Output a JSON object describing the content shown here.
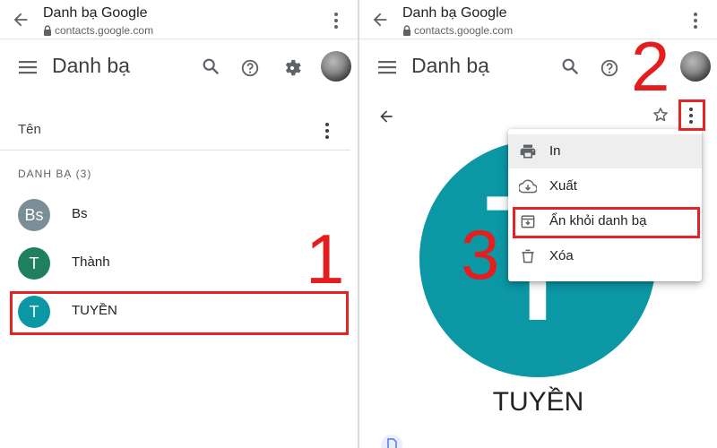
{
  "browser": {
    "page_title": "Danh bạ Google",
    "url": "contacts.google.com"
  },
  "app": {
    "title": "Danh bạ"
  },
  "list": {
    "sort_label": "Tên",
    "section_header": "DANH BẠ (3)",
    "contacts": [
      {
        "initials": "Bs",
        "name": "Bs",
        "color": "#7b8d97"
      },
      {
        "initials": "T",
        "name": "Thành",
        "color": "#1f7f5f"
      },
      {
        "initials": "T",
        "name": "TUYỀN",
        "color": "#0b97a4"
      }
    ]
  },
  "detail": {
    "avatar_letter": "T",
    "avatar_color": "#0b97a4",
    "name": "TUYỀN"
  },
  "menu": {
    "items": [
      {
        "label": "In",
        "icon": "print-icon"
      },
      {
        "label": "Xuất",
        "icon": "cloud-download-icon"
      },
      {
        "label": "Ẩn khỏi danh bạ",
        "icon": "archive-icon"
      },
      {
        "label": "Xóa",
        "icon": "trash-icon"
      }
    ]
  },
  "annotations": {
    "step1": "1",
    "step2": "2",
    "step3": "3",
    "color": "#e41e1e"
  }
}
